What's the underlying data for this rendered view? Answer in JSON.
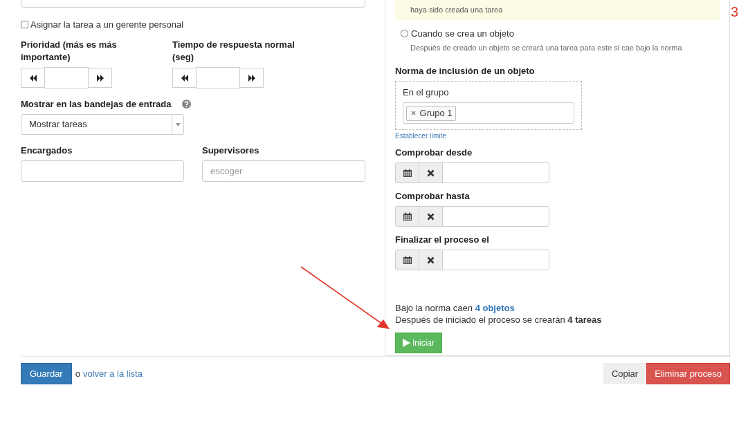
{
  "left": {
    "assign_checkbox": {
      "label": "Asignar la tarea a un gerente personal",
      "checked": false
    },
    "priority": {
      "label": "Prioridad (más es más importante)"
    },
    "response_time": {
      "label": "Tiempo de respuesta normal (seg)"
    },
    "inbox": {
      "label": "Mostrar en las bandejas de entrada",
      "value": "Mostrar tareas"
    },
    "assignees": {
      "label": "Encargados"
    },
    "supervisors": {
      "label": "Supervisores",
      "placeholder": "escoger"
    }
  },
  "right": {
    "notice": "haya sido creada una tarea",
    "radio": {
      "label": "Cuando se crea un objeto",
      "hint": "Después de creado un objeto se creará una tarea para este si cae bajo la norma",
      "selected": false
    },
    "rule_title": "Norma de inclusión de un objeto",
    "group_label": "En el grupo",
    "tags": [
      {
        "label": "Grupo 1"
      }
    ],
    "limit_link": "Establecer límite",
    "date_fields": [
      {
        "label": "Comprobar desde"
      },
      {
        "label": "Comprobar hasta"
      },
      {
        "label": "Finalizar el proceso el"
      }
    ],
    "objects_text": "Bajo la norma caen",
    "objects_link": "4 objetos",
    "tasks_text": "Después de iniciado el proceso se crearán **4 tareas**",
    "start_button": "Iniciar"
  },
  "footer": {
    "save_button": "Guardar",
    "or_text": "o",
    "back_link": "volver a la lista",
    "copy_button": "Copiar",
    "delete_button": "Eliminar proceso"
  },
  "annotation": "3"
}
